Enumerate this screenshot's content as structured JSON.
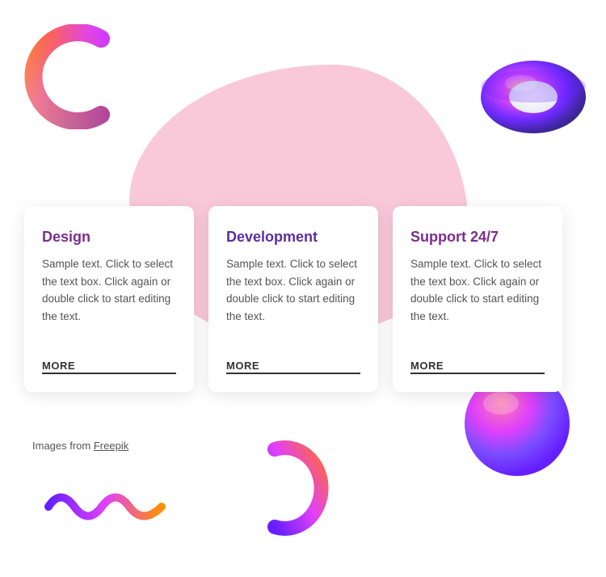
{
  "page": {
    "background": "#ffffff",
    "blob_color": "#f9c8d9"
  },
  "cards": [
    {
      "id": "design",
      "title": "Design",
      "title_color": "#9b2fa0",
      "text": "Sample text. Click to select the text box. Click again or double click to start editing the text.",
      "more_label": "MORE"
    },
    {
      "id": "development",
      "title": "Development",
      "title_color": "#5a2fa0",
      "text": "Sample text. Click to select the text box. Click again or double click to start editing the text.",
      "more_label": "MORE"
    },
    {
      "id": "support",
      "title": "Support 24/7",
      "title_color": "#9b2fa0",
      "text": "Sample text. Click to select the text box. Click again or double click to start editing the text.",
      "more_label": "MORE"
    }
  ],
  "footer": {
    "text": "Images from ",
    "link_label": "Freepik",
    "link_url": "#"
  }
}
